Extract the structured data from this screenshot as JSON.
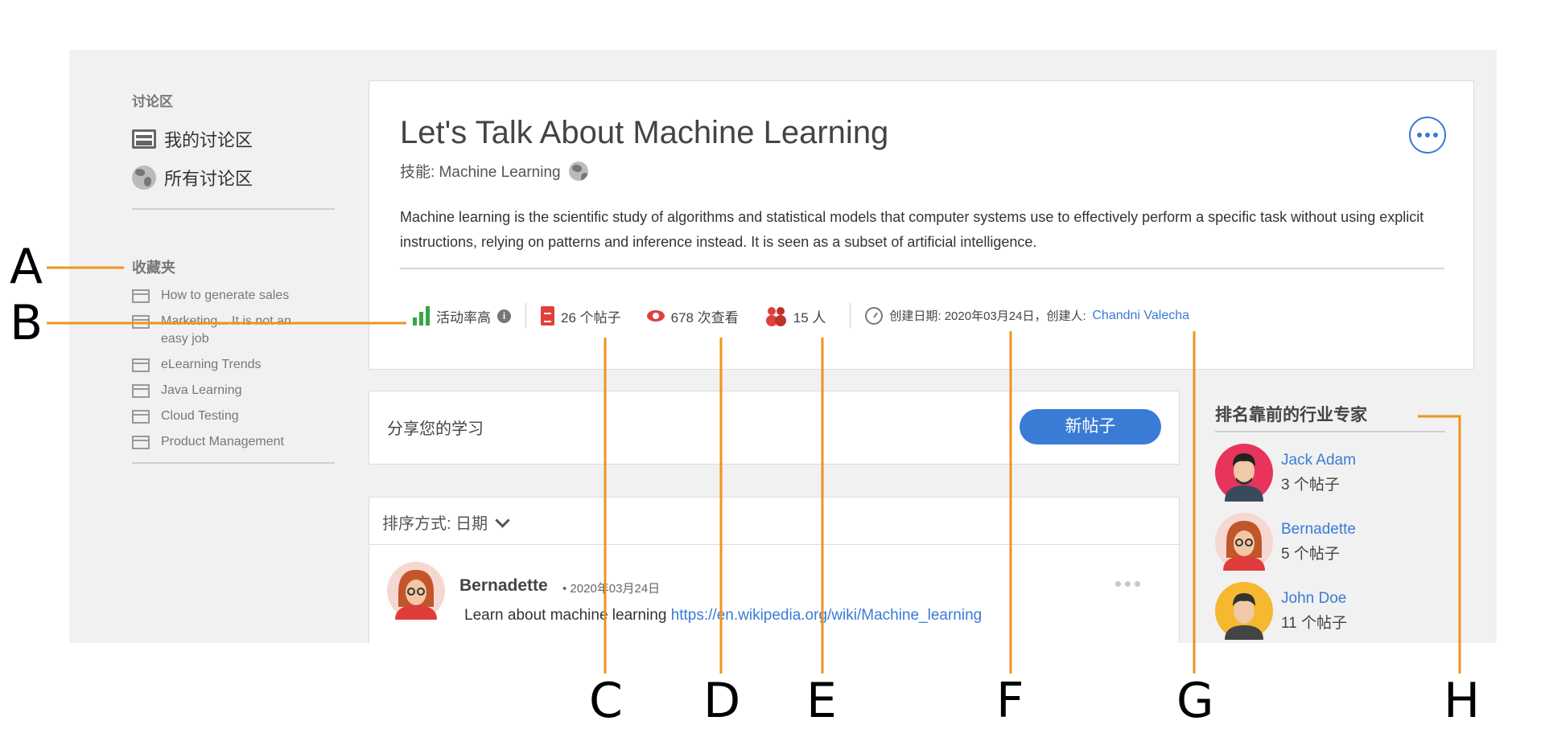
{
  "sidebar": {
    "section_title": "讨论区",
    "links": [
      {
        "label": "我的讨论区",
        "icon": "board-icon"
      },
      {
        "label": "所有讨论区",
        "icon": "globe-icon"
      }
    ],
    "favorites_title": "收藏夹",
    "favorites": [
      "How to generate sales",
      "Marketing... It is not an easy job",
      "eLearning Trends",
      "Java Learning",
      "Cloud Testing",
      "Product Management"
    ]
  },
  "discussion": {
    "title": "Let's Talk About Machine Learning",
    "skill": "技能: Machine Learning",
    "description": "Machine learning is the scientific study of algorithms and statistical models that computer systems use to effectively perform a specific task without using explicit instructions, relying on patterns and inference instead. It is seen as a subset of artificial intelligence.",
    "stats": {
      "activity": "活动率高",
      "posts": "26 个帖子",
      "views": "678 次查看",
      "members": "15 人",
      "created": "创建日期: 2020年03月24日，创建人:",
      "creator": "Chandni Valecha"
    },
    "colors": {
      "accent": "#3a7bd5",
      "activity": "#3aa345",
      "stat_icon": "#e0403a"
    }
  },
  "share": {
    "prompt": "分享您的学习",
    "new_post_button": "新帖子"
  },
  "posts": {
    "sort_label": "排序方式: 日期",
    "items": [
      {
        "author": "Bernadette",
        "date": "• 2020年03月24日",
        "text": "Learn about machine learning ",
        "link": "https://en.wikipedia.org/wiki/Machine_learning"
      }
    ]
  },
  "experts": {
    "title": "排名靠前的行业专家",
    "items": [
      {
        "name": "Jack Adam",
        "posts": "3 个帖子"
      },
      {
        "name": "Bernadette",
        "posts": "5 个帖子"
      },
      {
        "name": "John Doe",
        "posts": "11 个帖子"
      }
    ]
  },
  "callouts": {
    "letters": [
      "A",
      "B",
      "C",
      "D",
      "E",
      "F",
      "G",
      "H"
    ],
    "color": "#f0931e"
  }
}
